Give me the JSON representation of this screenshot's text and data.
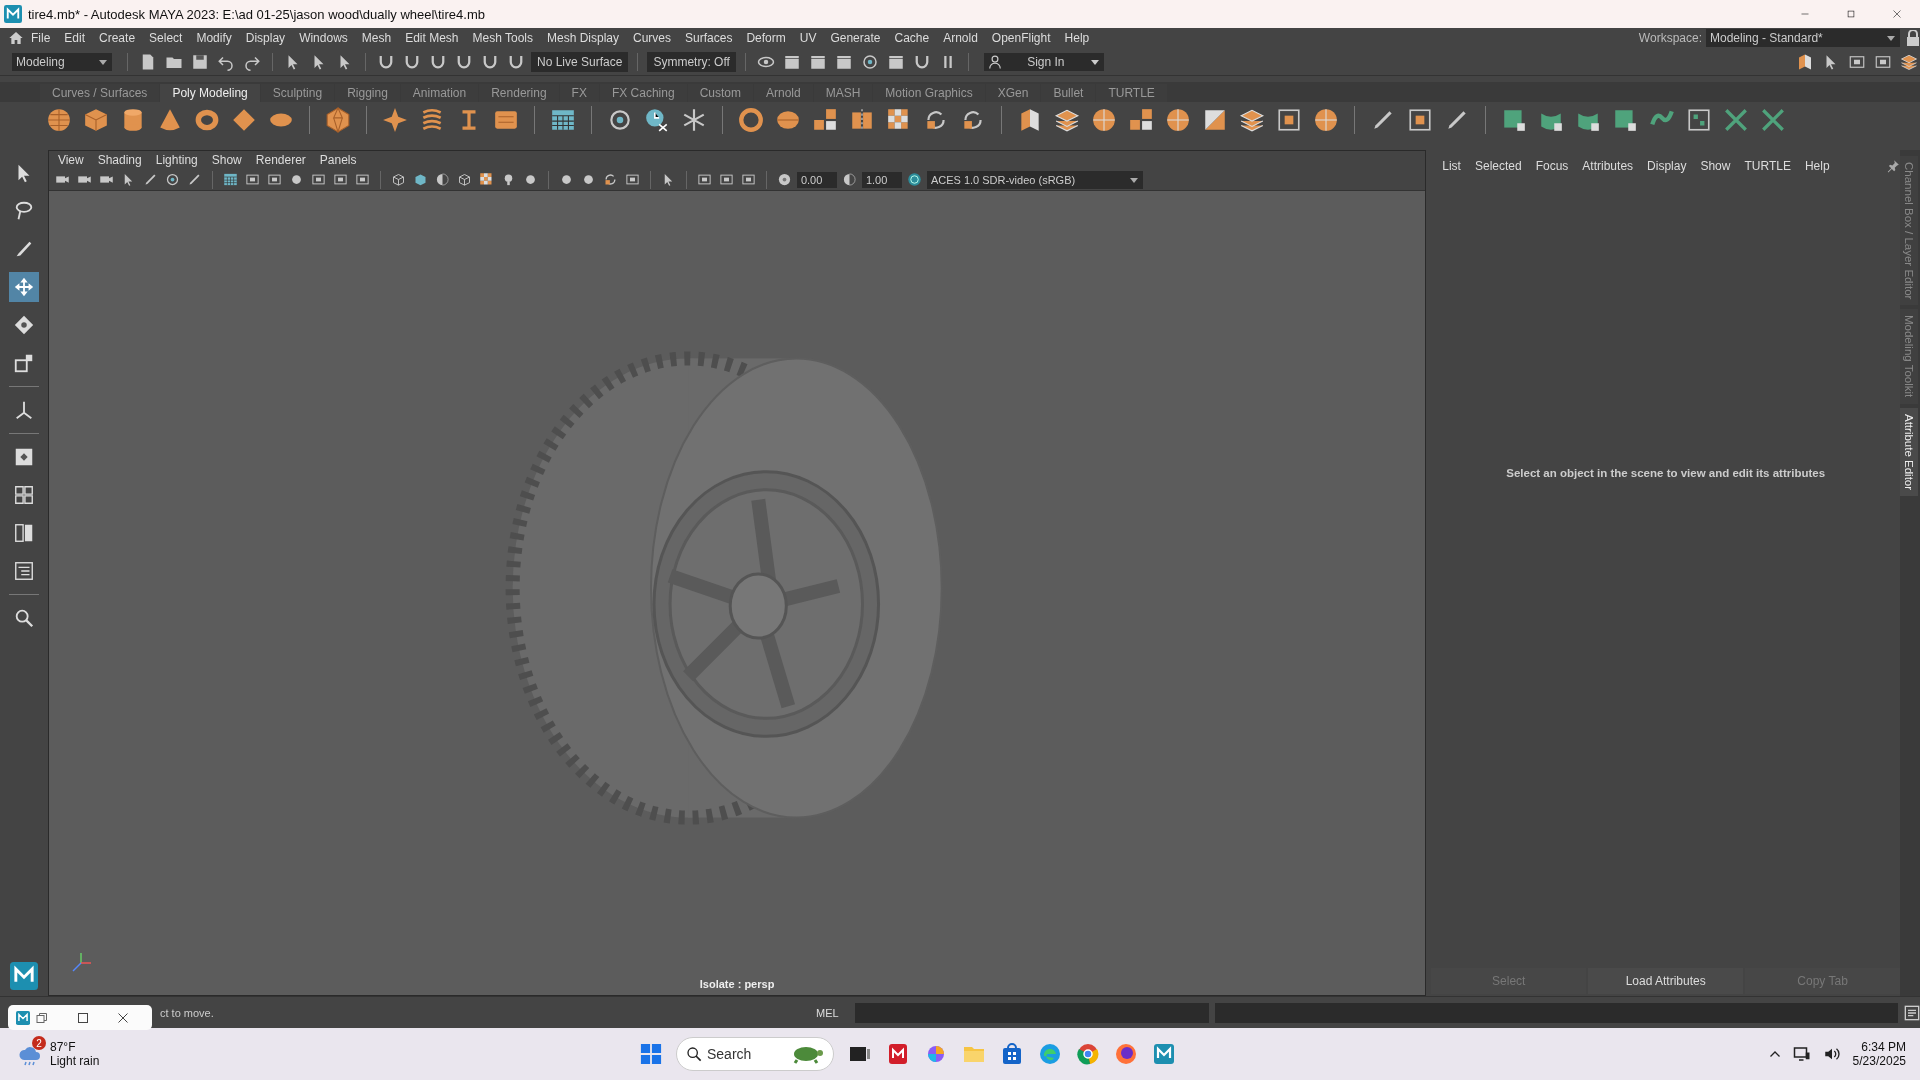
{
  "window": {
    "title": "tire4.mb* - Autodesk MAYA 2023: E:\\ad 01-25\\jason wood\\dually wheel\\tire4.mb"
  },
  "menu_bar": [
    "File",
    "Edit",
    "Create",
    "Select",
    "Modify",
    "Display",
    "Windows",
    "Mesh",
    "Edit Mesh",
    "Mesh Tools",
    "Mesh Display",
    "Curves",
    "Surfaces",
    "Deform",
    "UV",
    "Generate",
    "Cache",
    "Arnold",
    "OpenFlight",
    "Help"
  ],
  "workspace": {
    "label": "Workspace:",
    "value": "Modeling - Standard*"
  },
  "status_line": {
    "menu_set": "Modeling",
    "live_surface": "No Live Surface",
    "symmetry": "Symmetry: Off",
    "sign_in": "Sign In"
  },
  "shelf_tabs": [
    {
      "label": "Curves / Surfaces",
      "selected": false
    },
    {
      "label": "Poly Modeling",
      "selected": true
    },
    {
      "label": "Sculpting",
      "selected": false
    },
    {
      "label": "Rigging",
      "selected": false
    },
    {
      "label": "Animation",
      "selected": false
    },
    {
      "label": "Rendering",
      "selected": false
    },
    {
      "label": "FX",
      "selected": false
    },
    {
      "label": "FX Caching",
      "selected": false
    },
    {
      "label": "Custom",
      "selected": false
    },
    {
      "label": "Arnold",
      "selected": false
    },
    {
      "label": "MASH",
      "selected": false
    },
    {
      "label": "Motion Graphics",
      "selected": false
    },
    {
      "label": "XGen",
      "selected": false
    },
    {
      "label": "Bullet",
      "selected": false
    },
    {
      "label": "TURTLE",
      "selected": false
    }
  ],
  "tools": [
    {
      "kind": "select",
      "selected": false
    },
    {
      "kind": "lasso",
      "selected": false
    },
    {
      "kind": "paint",
      "selected": false
    },
    {
      "kind": "move",
      "selected": true
    },
    {
      "kind": "rotate",
      "selected": false
    },
    {
      "kind": "scale",
      "selected": false
    },
    {
      "kind": "pivot",
      "selected": false
    },
    {
      "kind": "layout",
      "selected": false
    },
    {
      "kind": "grid",
      "selected": false
    },
    {
      "kind": "split",
      "selected": false
    },
    {
      "kind": "outliner",
      "selected": false
    },
    {
      "kind": "search",
      "selected": false
    }
  ],
  "viewport": {
    "menus": [
      "View",
      "Shading",
      "Lighting",
      "Show",
      "Renderer",
      "Panels"
    ],
    "exposure": "0.00",
    "gamma": "1.00",
    "color_space": "ACES 1.0 SDR-video (sRGB)",
    "label": "Isolate : persp"
  },
  "attribute_editor": {
    "menus": [
      "List",
      "Selected",
      "Focus",
      "Attributes",
      "Display",
      "Show",
      "TURTLE",
      "Help"
    ],
    "message": "Select an object in the scene to view and edit its attributes",
    "buttons": [
      {
        "label": "Select",
        "disabled": true
      },
      {
        "label": "Load Attributes",
        "disabled": false
      },
      {
        "label": "Copy Tab",
        "disabled": true
      }
    ]
  },
  "side_tabs": [
    {
      "label": "Channel Box / Layer Editor",
      "selected": false
    },
    {
      "label": "Modeling Toolkit",
      "selected": false
    },
    {
      "label": "Attribute Editor",
      "selected": true
    }
  ],
  "command_line": {
    "help_text": "ct to move.",
    "language": "MEL"
  },
  "taskbar": {
    "temperature": "87°F",
    "condition": "Light rain",
    "badge": "2",
    "search": {
      "placeholder": "Search"
    },
    "time": "6:34 PM",
    "date": "5/23/2025"
  }
}
